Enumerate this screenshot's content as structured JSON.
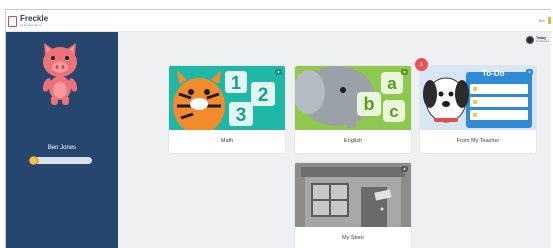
{
  "header": {
    "logo_name": "Freckle",
    "logo_sub": "by Renaissance",
    "right_link": "Ben",
    "accent_color": "#e4b53b"
  },
  "sidebar": {
    "background": "#26466f",
    "avatar": "pig-avatar",
    "user_name": "Ben Jones",
    "progress": 0.15
  },
  "streak": {
    "icon": "clock-icon",
    "title": "Today",
    "value": "0 minutes"
  },
  "cards": [
    {
      "label": "Math",
      "badge": "★",
      "art": "tiger-numbers",
      "color": "#1fb7a6"
    },
    {
      "label": "English",
      "badge": "★",
      "art": "elephant-letters",
      "color": "#8fc84e"
    },
    {
      "label": "From My Teacher",
      "badge": "★",
      "art": "dog-todo",
      "color": "#d8e6f3",
      "notification": "1",
      "todo_title": "To-Do"
    },
    {
      "label": "My Store",
      "badge": "★",
      "art": "storefront",
      "color": "#8c8c8c"
    }
  ]
}
